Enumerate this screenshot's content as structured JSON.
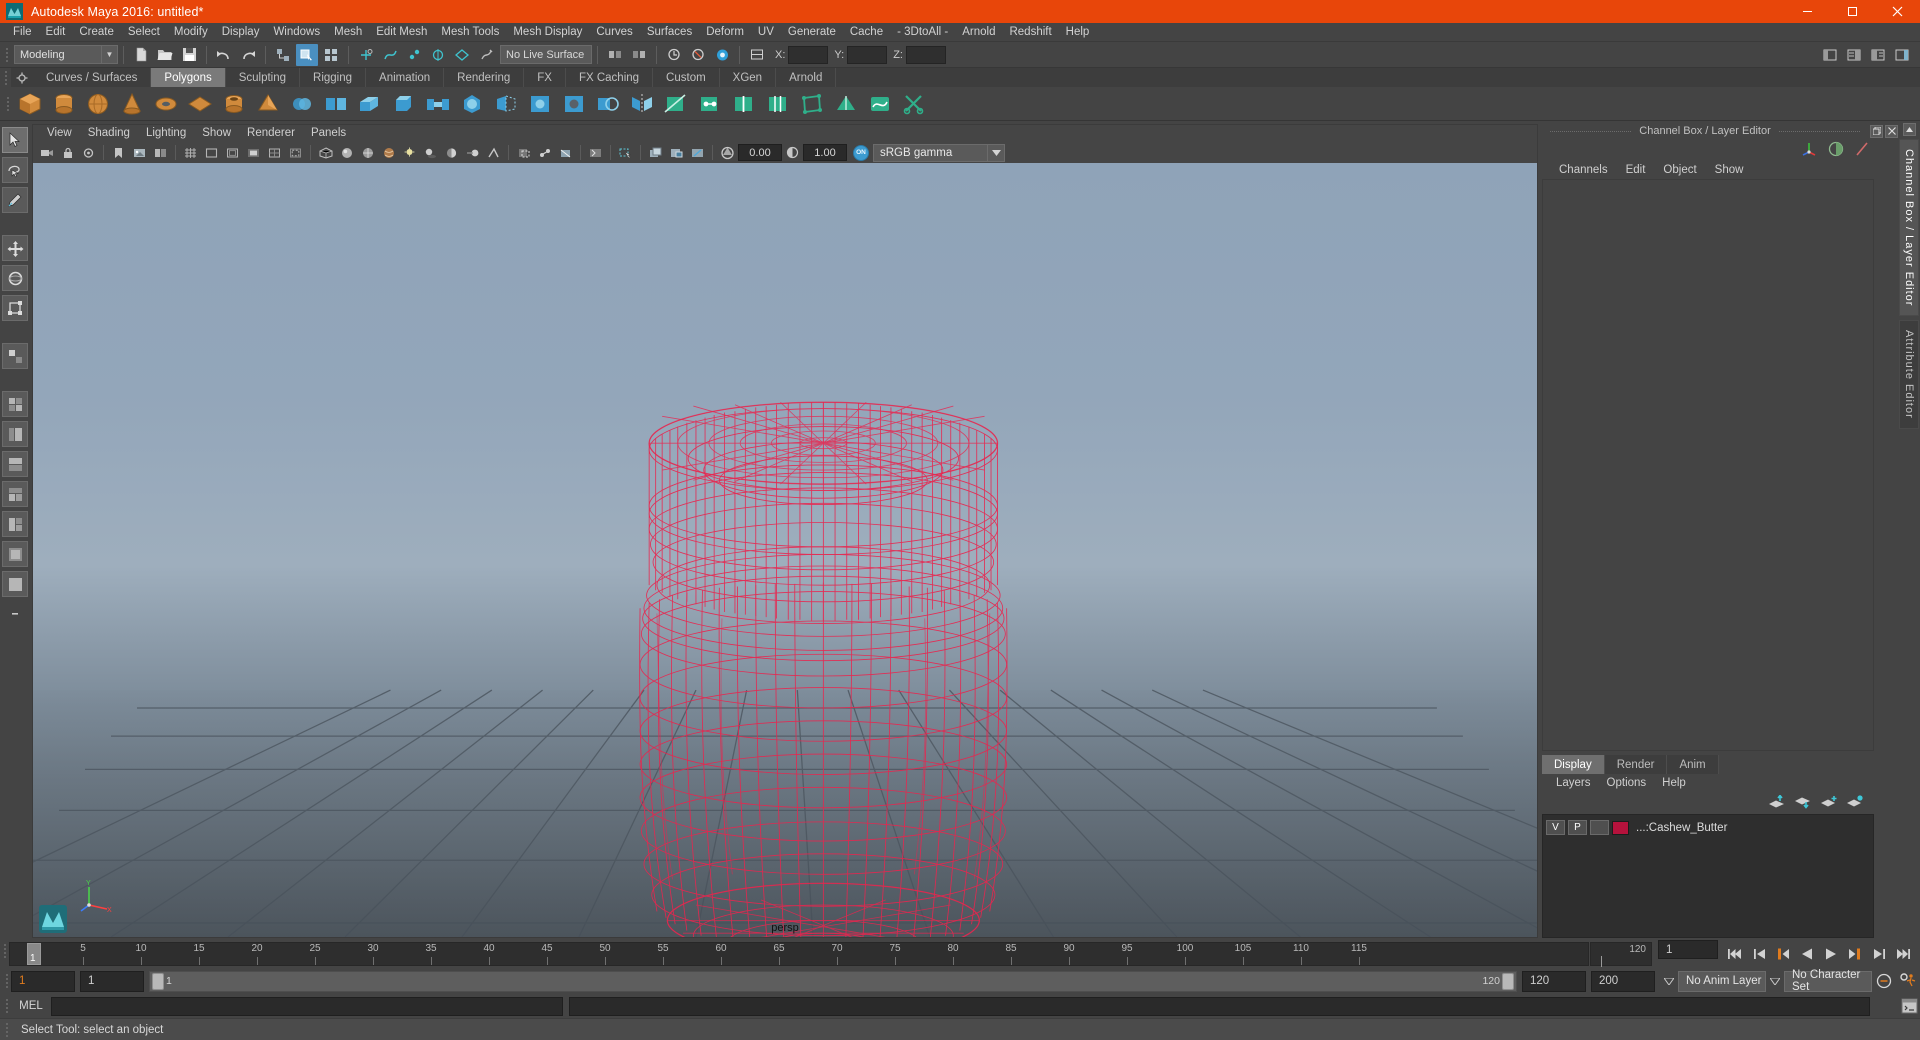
{
  "window": {
    "title": "Autodesk Maya 2016: untitled*",
    "logo_icon": "maya-logo-icon",
    "minimize_label": "–",
    "maximize_label": "❐",
    "close_label": "✕",
    "titlebar_color": "#e8460a"
  },
  "menubar": {
    "items": [
      "File",
      "Edit",
      "Create",
      "Select",
      "Modify",
      "Display",
      "Windows",
      "Mesh",
      "Edit Mesh",
      "Mesh Tools",
      "Mesh Display",
      "Curves",
      "Surfaces",
      "Deform",
      "UV",
      "Generate",
      "Cache",
      "- 3DtoAll -",
      "Arnold",
      "Redshift",
      "Help"
    ]
  },
  "statusline": {
    "mode": "Modeling",
    "live_surface": "No Live Surface",
    "coord_labels": [
      "X:",
      "Y:",
      "Z:"
    ],
    "coord_values": [
      "",
      "",
      ""
    ],
    "selection_mask_icons": [
      "select-by-hierarchy-icon",
      "select-by-object-icon",
      "select-by-component-icon"
    ],
    "file_icons": [
      "new-scene-icon",
      "open-scene-icon",
      "save-scene-icon",
      "undo-icon",
      "redo-icon"
    ],
    "snap_icons": [
      "snap-to-grid-icon",
      "snap-to-curve-icon",
      "snap-to-point-icon",
      "snap-to-projected-center-icon",
      "snap-to-view-plane-icon",
      "make-live-icon"
    ],
    "right_icons": [
      "show-hide-editors-icon",
      "attribute-editor-icon",
      "tool-settings-icon",
      "channel-box-icon"
    ]
  },
  "shelf": {
    "tabs": [
      "Curves / Surfaces",
      "Polygons",
      "Sculpting",
      "Rigging",
      "Animation",
      "Rendering",
      "FX",
      "FX Caching",
      "Custom",
      "XGen",
      "Arnold"
    ],
    "active_tab": "Polygons",
    "gear_icon": "shelf-options-gear-icon",
    "icons": [
      "poly-cube-icon",
      "poly-cylinder-icon",
      "poly-sphere-icon",
      "poly-cone-icon",
      "poly-torus-icon",
      "poly-plane-icon",
      "poly-pipe-icon",
      "poly-prism-icon",
      "combine-icon",
      "separate-icon",
      "extrude-icon",
      "bevel-icon",
      "bridge-icon",
      "smooth-icon",
      "append-polygon-icon",
      "fill-hole-icon",
      "make-hole-icon",
      "booleans-icon",
      "mirror-icon",
      "multi-cut-icon",
      "target-weld-icon",
      "insert-edge-loop-icon",
      "offset-edge-loop-icon",
      "quad-draw-icon",
      "soft-edge-icon",
      "hard-edge-icon",
      "harden-edge-icon",
      "crease-icon",
      "vertex-normal-icon",
      "sculpt-icon",
      "cut-faces-icon"
    ]
  },
  "toolbox": {
    "items": [
      "select-tool-icon",
      "lasso-select-tool-icon",
      "paint-select-tool-icon",
      "move-tool-icon",
      "rotate-tool-icon",
      "scale-tool-icon",
      "last-tool-icon",
      "four-view-layout-icon",
      "persp-outliner-layout-icon",
      "persp-graph-layout-icon",
      "persp-hypershade-layout-icon",
      "two-pane-stacked-layout-icon",
      "two-pane-side-layout-icon",
      "single-perspective-layout-icon",
      "more-layouts-icon"
    ]
  },
  "viewport": {
    "menus": [
      "View",
      "Shading",
      "Lighting",
      "Show",
      "Renderer",
      "Panels"
    ],
    "camera_label": "persp",
    "exposure_value": "0.00",
    "gamma_value": "1.00",
    "color_management": "sRGB gamma",
    "color_mgmt_toggle": "ON",
    "toolbar_icons": [
      "select-camera-icon",
      "lock-camera-icon",
      "camera-attributes-icon",
      "bookmark-icon",
      "image-plane-icon",
      "two-pane-icon",
      "grid-toggle-icon",
      "film-gate-icon",
      "resolution-gate-icon",
      "gate-mask-icon",
      "field-chart-icon",
      "safe-action-icon",
      "safe-title-icon",
      "wireframe-icon",
      "smooth-shade-icon",
      "shaded-wireframe-icon",
      "textured-icon",
      "use-lights-icon",
      "shadows-icon",
      "ssao-icon",
      "motion-blur-icon",
      "multisample-icon",
      "depth-peeling-icon",
      "xray-icon",
      "xray-joints-icon",
      "xray-active-icon",
      "isolate-select-icon",
      "grid-icon",
      "exposure-icon",
      "gamma-icon"
    ],
    "axis_labels": [
      "Y",
      "X",
      "Z"
    ],
    "model_name": "Cashew Butter jar wireframe",
    "wireframe_color": "#e8264f",
    "background_top": "#8fa3b8",
    "background_bottom": "#555e66"
  },
  "right_panel": {
    "title": "Channel Box / Layer Editor",
    "restore_icon": "restore-panel-icon",
    "close_icon": "close-panel-icon",
    "header_icons": [
      "axis-gizmo-icon",
      "half-circle-icon",
      "slash-icon"
    ],
    "channel_menus": [
      "Channels",
      "Edit",
      "Object",
      "Show"
    ],
    "layer_tabs": [
      "Display",
      "Render",
      "Anim"
    ],
    "active_layer_tab": "Display",
    "layer_menus": [
      "Layers",
      "Options",
      "Help"
    ],
    "layer_buttons": [
      "move-layer-up-icon",
      "move-layer-down-icon",
      "new-layer-icon",
      "new-layer-from-selected-icon"
    ],
    "layers": [
      {
        "visibility": "V",
        "playback": "P",
        "shading": "",
        "color": "#b5123c",
        "name": "...:Cashew_Butter"
      }
    ]
  },
  "vertical_tabs": {
    "items": [
      "Channel Box / Layer Editor",
      "Attribute Editor"
    ],
    "active": "Channel Box / Layer Editor",
    "scroll_up_icon": "scroll-up-icon",
    "scroll_down_icon": "scroll-down-icon"
  },
  "timeline": {
    "start_frame": "1",
    "end_frame": "120",
    "current_frame": "1",
    "ticks": [
      5,
      10,
      15,
      20,
      25,
      30,
      35,
      40,
      45,
      50,
      55,
      60,
      65,
      70,
      75,
      80,
      85,
      90,
      95,
      100,
      105,
      110,
      115,
      120
    ],
    "playhead_label": "1",
    "playback_buttons": [
      "go-to-start-icon",
      "step-back-keyframe-icon",
      "step-back-frame-icon",
      "play-backwards-icon",
      "play-forwards-icon",
      "step-forward-frame-icon",
      "step-forward-keyframe-icon",
      "go-to-end-icon"
    ]
  },
  "range_slider": {
    "anim_start": "1",
    "range_start": "1",
    "bar_left_label": "1",
    "bar_right_label": "120",
    "range_end": "120",
    "anim_end": "200",
    "anim_layer": "No Anim Layer",
    "character_set": "No Character Set",
    "auto_keyframe_icon": "auto-keyframe-icon",
    "anim_prefs_icon": "animation-preferences-icon"
  },
  "command_line": {
    "label": "MEL",
    "input_value": "",
    "output_value": "",
    "script_editor_icon": "script-editor-icon"
  },
  "helpline": {
    "text": "Select Tool: select an object"
  }
}
